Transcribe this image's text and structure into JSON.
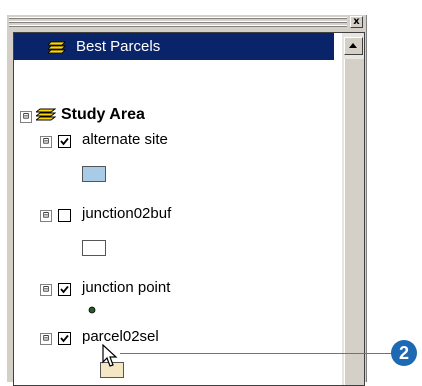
{
  "header": {
    "label": "Best Parcels"
  },
  "window": {
    "close_glyph": "x"
  },
  "group": {
    "name": "Study Area",
    "expander": "⊟"
  },
  "layers": [
    {
      "name": "alternate site",
      "checked": true,
      "expander": "⊟",
      "symbol": "polygon",
      "fill": "#a8cce8"
    },
    {
      "name": "junction02buf",
      "checked": false,
      "expander": "⊟",
      "symbol": "polygon",
      "fill": "#ffffff"
    },
    {
      "name": "junction point",
      "checked": true,
      "expander": "⊟",
      "symbol": "point",
      "fill": "#2a5a2a"
    },
    {
      "name": "parcel02sel",
      "checked": true,
      "expander": "⊟",
      "symbol": "polygon",
      "fill": "#f5e6c4"
    }
  ],
  "callout": {
    "number": "2",
    "color": "#1e69b3"
  },
  "icons": {
    "layer_group": "layers-icon",
    "cursor": "arrow-cursor-icon"
  }
}
